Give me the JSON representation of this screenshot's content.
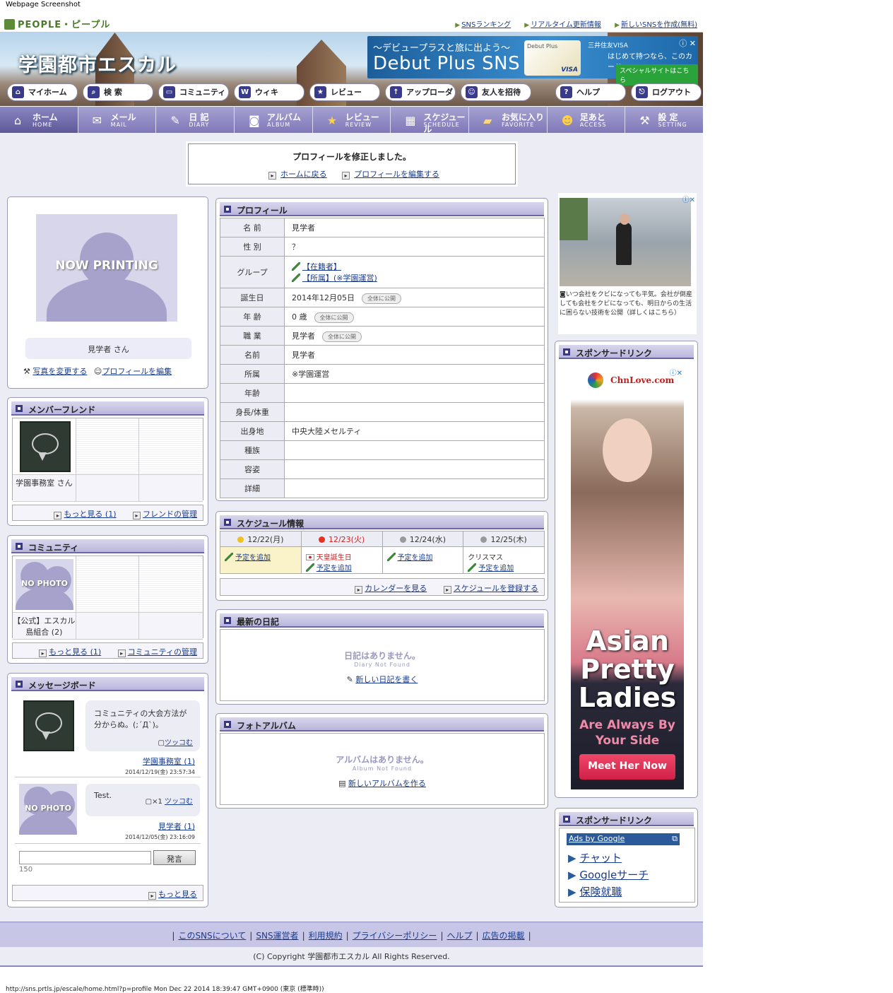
{
  "screenshot_label": "Webpage Screenshot",
  "people_brand": "PEOPLE・ピープル",
  "top_links": [
    "SNSランキング",
    "リアルタイム更新情報",
    "新しいSNSを作成(無料)"
  ],
  "site_title": "学園都市エスカル",
  "top_ad": {
    "line1": "〜デビュープラスと旅に出よう〜",
    "line2": "Debut Plus SNS",
    "card_label": "Debut Plus",
    "card_brand": "VISA",
    "brand": "三井住友VISA",
    "sub": "はじめて持つなら、このカード。",
    "cta": "スペシャルサイトはこちら"
  },
  "pills": [
    "マイホーム",
    "検 索",
    "コミュニティ",
    "ウィキ",
    "レビュー",
    "アップローダ",
    "友人を招待",
    "ヘルプ",
    "ログアウト"
  ],
  "gnav": [
    {
      "ja": "ホーム",
      "en": "HOME",
      "icon": "home-icon"
    },
    {
      "ja": "メール",
      "en": "MAIL",
      "icon": "mail-icon"
    },
    {
      "ja": "日 記",
      "en": "DIARY",
      "icon": "diary-icon"
    },
    {
      "ja": "アルバム",
      "en": "ALBUM",
      "icon": "camera-icon"
    },
    {
      "ja": "レビュー",
      "en": "REVIEW",
      "icon": "star-icon"
    },
    {
      "ja": "スケジュール",
      "en": "SCHEDULE",
      "icon": "calendar-icon"
    },
    {
      "ja": "お気に入り",
      "en": "FAVORITE",
      "icon": "folder-icon"
    },
    {
      "ja": "足あと",
      "en": "ACCESS",
      "icon": "smile-icon"
    },
    {
      "ja": "設 定",
      "en": "SETTING",
      "icon": "wrench-icon"
    }
  ],
  "notice": {
    "message": "プロフィールを修正しました。",
    "link_home": "ホームに戻る",
    "link_edit": "プロフィールを編集する"
  },
  "left_profile": {
    "photo_text": "NOW PRINTING",
    "name": "見学者 さん",
    "change_photo": "写真を変更する",
    "edit_profile": "プロフィールを編集"
  },
  "friends": {
    "title": "メンバーフレンド",
    "items": [
      {
        "name": "学園事務室 さん"
      }
    ],
    "more": "もっと見る (1)",
    "manage": "フレンドの管理"
  },
  "community": {
    "title": "コミュニティ",
    "items": [
      {
        "name": "【公式】エスカル島組合 (2)",
        "photo_text": "NO PHOTO"
      }
    ],
    "more": "もっと見る (1)",
    "manage": "コミュニティの管理"
  },
  "message_board": {
    "title": "メッセージボード",
    "messages": [
      {
        "text": "コミュニティの大会方法が分からぬ。(;´Д`)。",
        "reply": "ツッコむ",
        "count": "",
        "author": "学園事務室 (1)",
        "date": "2014/12/19(金) 23:57:34"
      },
      {
        "text": "Test.",
        "reply": "ツッコむ",
        "count": "×1",
        "author": "見学者 (1)",
        "date": "2014/12/05(金) 23:16:09",
        "photo_text": "NO PHOTO"
      }
    ],
    "post_button": "発言",
    "char_count": "150",
    "more": "もっと見る"
  },
  "profile": {
    "title": "プロフィール",
    "public_label": "全体に公開",
    "rows": [
      {
        "key": "名 前",
        "value": "見学者"
      },
      {
        "key": "性 別",
        "value": "？"
      },
      {
        "key": "グループ",
        "value": "【在籍者】",
        "value2": "【所属】(※学園運営)"
      },
      {
        "key": "誕生日",
        "value": "2014年12月05日",
        "public": true
      },
      {
        "key": "年 齢",
        "value": "0 歳",
        "public": true
      },
      {
        "key": "職 業",
        "value": "見学者",
        "public": true
      },
      {
        "key": "名前",
        "value": "見学者"
      },
      {
        "key": "所属",
        "value": "※学園運営"
      },
      {
        "key": "年齢",
        "value": ""
      },
      {
        "key": "身長/体重",
        "value": ""
      },
      {
        "key": "出身地",
        "value": "中央大陸メセルティ"
      },
      {
        "key": "種族",
        "value": ""
      },
      {
        "key": "容姿",
        "value": ""
      },
      {
        "key": "詳細",
        "value": ""
      }
    ]
  },
  "schedule": {
    "title": "スケジュール情報",
    "days": [
      {
        "label": "12/22(月)",
        "dot": "#f0c020",
        "events": [],
        "add": "予定を追加"
      },
      {
        "label": "12/23(火)",
        "dot": "#e83020",
        "events": [
          "天皇誕生日"
        ],
        "add": "予定を追加"
      },
      {
        "label": "12/24(水)",
        "dot": "#999999",
        "events": [],
        "add": "予定を追加"
      },
      {
        "label": "12/25(木)",
        "dot": "#999999",
        "events": [
          "クリスマス"
        ],
        "add": "予定を追加"
      }
    ],
    "calendar": "カレンダーを見る",
    "register": "スケジュールを登録する"
  },
  "diary": {
    "title": "最新の日記",
    "empty_ja": "日記はありません。",
    "empty_en": "Diary Not Found",
    "new": "新しい日記を書く"
  },
  "album": {
    "title": "フォトアルバム",
    "empty_ja": "アルバムはありません。",
    "empty_en": "Album Not Found",
    "new": "新しいアルバムを作る"
  },
  "right_ad1": {
    "caption": "いつ会社をクビになっても平気。会社が倒産しても会社をクビになっても、明日からの生活に困らない技術を公開（詳しくはこちら）"
  },
  "sponsor1": {
    "title": "スポンサードリンク",
    "brand": "ChnLove.com",
    "headline1": "Asian",
    "headline2": "Pretty",
    "headline3": "Ladies",
    "sub": "Are Always By Your Side",
    "cta": "Meet Her Now"
  },
  "sponsor2": {
    "title": "スポンサードリンク",
    "ads_by": "Ads by Google",
    "links": [
      "チャット",
      "Googleサーチ",
      "保険就職"
    ]
  },
  "footer": {
    "links": [
      "このSNSについて",
      "SNS運営者",
      "利用規約",
      "プライバシーポリシー",
      "ヘルプ",
      "広告の掲載"
    ],
    "copyright": "(C) Copyright 学園都市エスカル All Rights Reserved."
  },
  "status_url": "http://sns.prtls.jp/escale/home.html?p=profile Mon Dec 22 2014 18:39:47 GMT+0900 (東京 (標準時))"
}
